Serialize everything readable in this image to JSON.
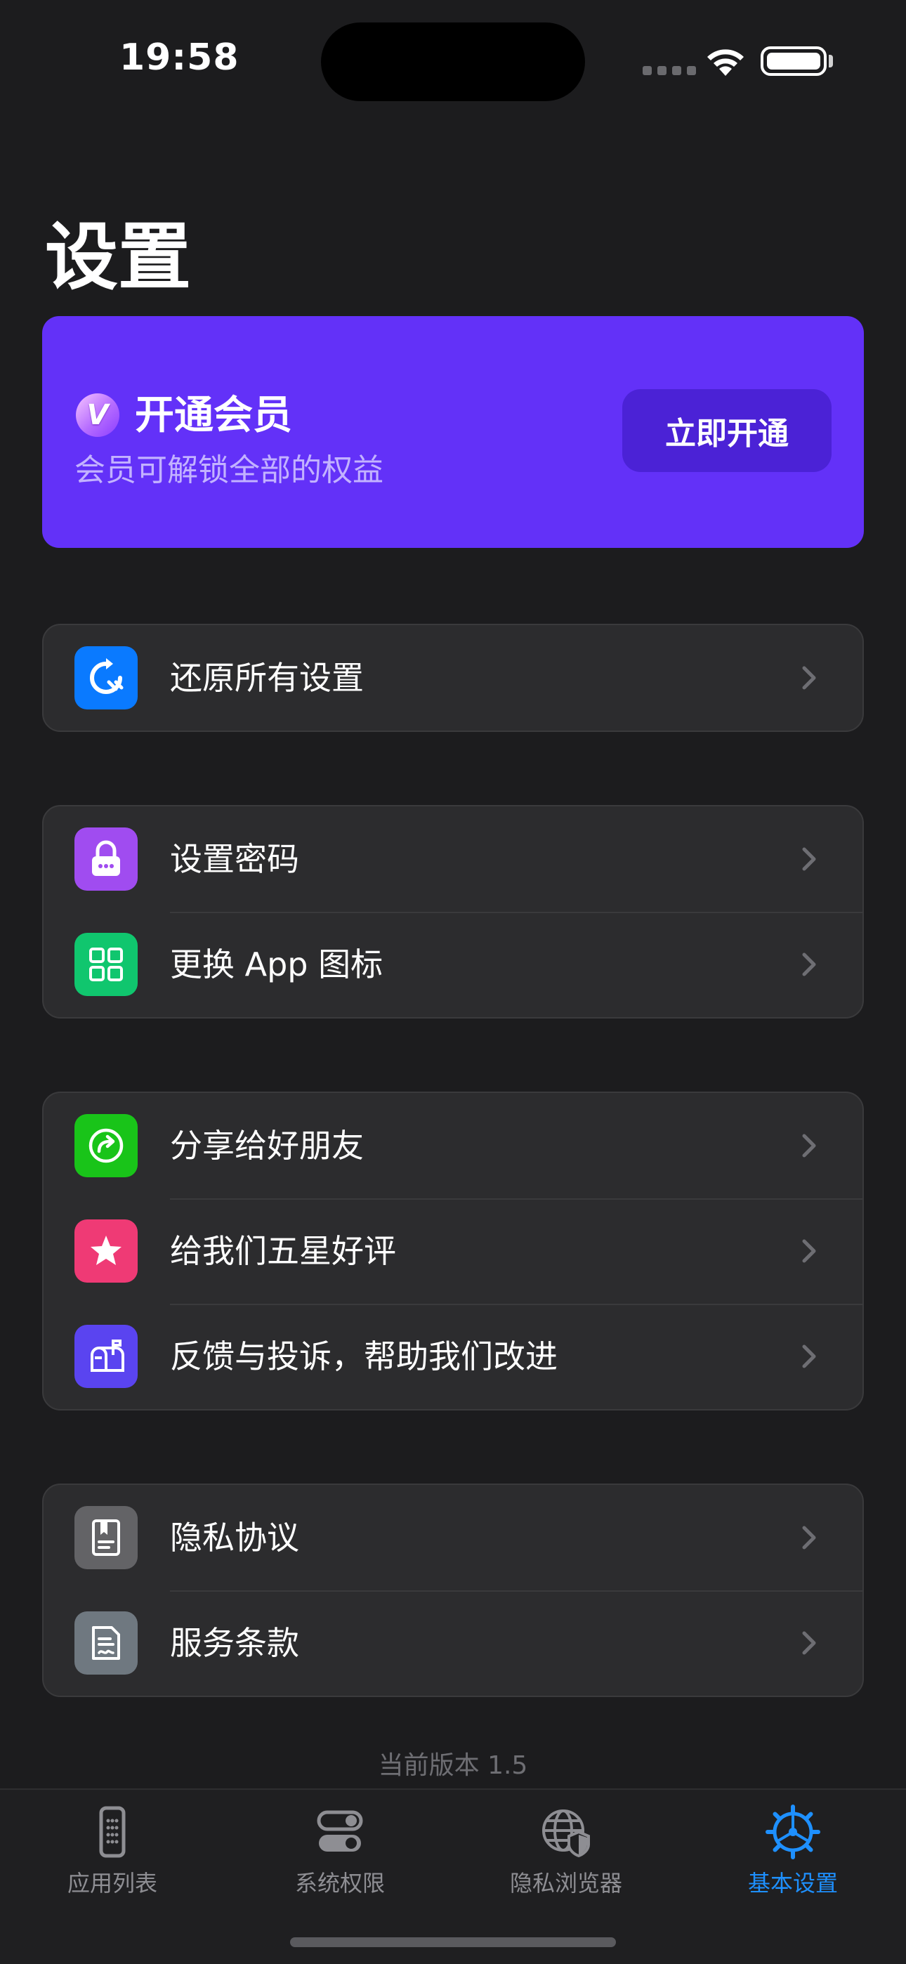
{
  "status": {
    "time": "19:58"
  },
  "page_title": "设置",
  "vip": {
    "badge": "V",
    "title": "开通会员",
    "subtitle": "会员可解锁全部的权益",
    "button": "立即开通",
    "card_color": "#6331f8"
  },
  "groups": [
    {
      "items": [
        {
          "label": "还原所有设置",
          "icon": "reset-icon",
          "color": "#0a7aff"
        }
      ]
    },
    {
      "items": [
        {
          "label": "设置密码",
          "icon": "lock-icon",
          "color": "#a04cf0"
        },
        {
          "label": "更换 App 图标",
          "icon": "app-icon-grid-icon",
          "color": "#10c66e"
        }
      ]
    },
    {
      "items": [
        {
          "label": "分享给好朋友",
          "icon": "share-icon",
          "color": "#19c419"
        },
        {
          "label": "给我们五星好评",
          "icon": "star-icon",
          "color": "#ef3a75"
        },
        {
          "label": "反馈与投诉，帮助我们改进",
          "icon": "mailbox-icon",
          "color": "#5a44f0"
        }
      ]
    },
    {
      "items": [
        {
          "label": "隐私协议",
          "icon": "privacy-doc-icon",
          "color": "#636366"
        },
        {
          "label": "服务条款",
          "icon": "terms-doc-icon",
          "color": "#6f7880"
        }
      ]
    }
  ],
  "version": "当前版本 1.5",
  "tabs": [
    {
      "label": "应用列表",
      "icon": "phone-icon",
      "active": false
    },
    {
      "label": "系统权限",
      "icon": "toggles-icon",
      "active": false
    },
    {
      "label": "隐私浏览器",
      "icon": "globe-shield-icon",
      "active": false
    },
    {
      "label": "基本设置",
      "icon": "gear-icon",
      "active": true
    }
  ],
  "accent_color": "#1e90ff"
}
